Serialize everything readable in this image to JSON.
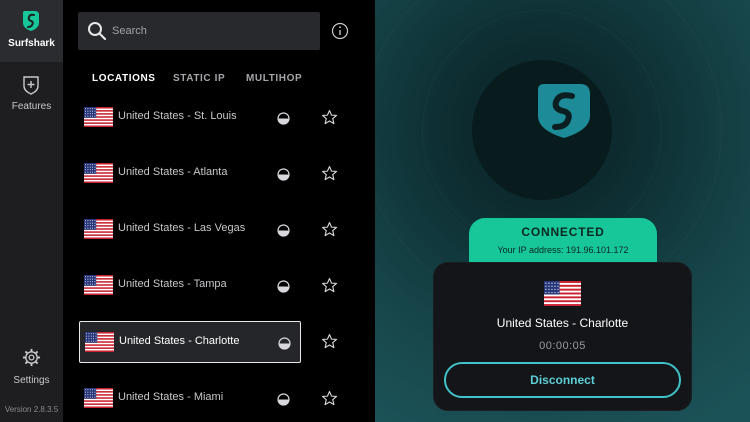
{
  "app": {
    "brand_label": "Surfshark",
    "version_label": "Version 2.8.3.5",
    "brand_color": "#17c79a",
    "accent_color": "#40c2c8"
  },
  "sidebar": {
    "items": [
      {
        "label": "Features",
        "icon": "shield-plus-icon"
      },
      {
        "label": "Settings",
        "icon": "gear-icon"
      }
    ]
  },
  "search": {
    "placeholder": "Search",
    "value": "",
    "icon": "search-icon"
  },
  "info_icon": "info-icon",
  "tabs": [
    {
      "label": "LOCATIONS",
      "active": true
    },
    {
      "label": "STATIC IP",
      "active": false
    },
    {
      "label": "MULTIHOP",
      "active": false
    }
  ],
  "locations": [
    {
      "name": "United States - St. Louis",
      "selected": false,
      "load": 0.5
    },
    {
      "name": "United States - Atlanta",
      "selected": false,
      "load": 0.5
    },
    {
      "name": "United States - Las Vegas",
      "selected": false,
      "load": 0.5
    },
    {
      "name": "United States - Tampa",
      "selected": false,
      "load": 0.5
    },
    {
      "name": "United States - Charlotte",
      "selected": true,
      "load": 0.5
    },
    {
      "name": "United States - Miami",
      "selected": false,
      "load": 0.5
    }
  ],
  "connection": {
    "status": "CONNECTED",
    "ip_text": "Your IP address: 191.96.101.172",
    "status_color": "#17c79a",
    "country": "United States - Charlotte",
    "timer": "00:00:05",
    "disconnect_label": "Disconnect"
  }
}
